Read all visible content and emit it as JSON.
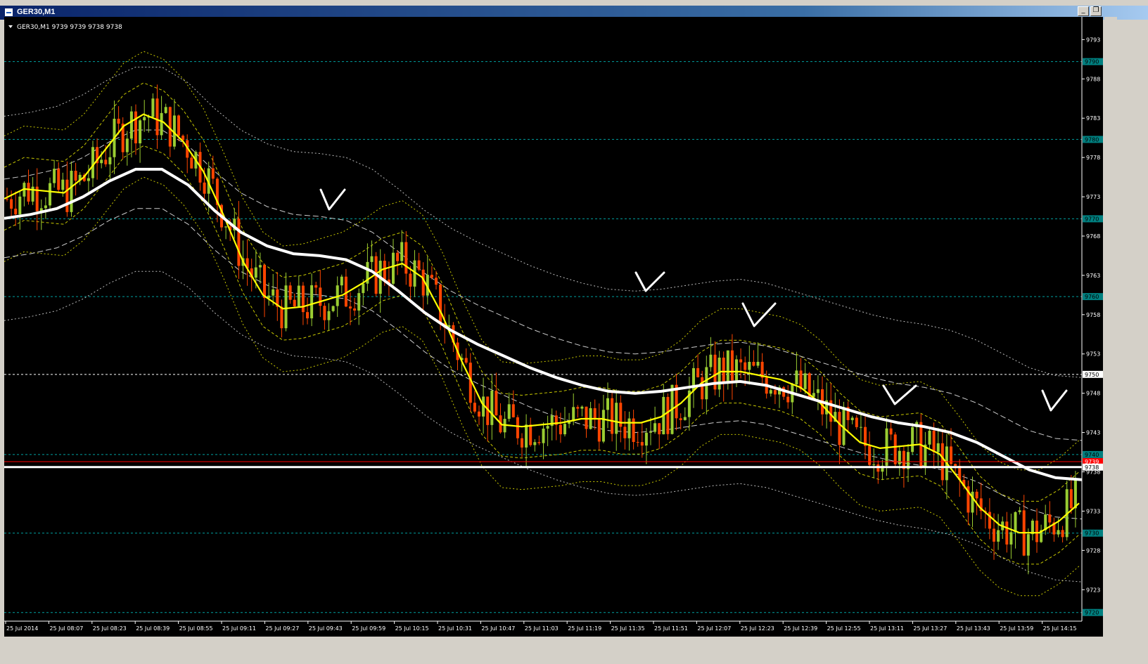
{
  "window": {
    "title": "GER30,M1"
  },
  "chart_info": {
    "text": "GER30,M1  9739 9739 9738 9738"
  },
  "colors": {
    "background": "#000000",
    "bull_candle": "#9acd32",
    "bear_candle": "#ff4500",
    "ma_fast": "#ffff00",
    "ma_slow": "#ffffff",
    "level_line": "#00a0a0",
    "bid_line": "#ff0000"
  },
  "price_axis": {
    "ticks": [
      {
        "label": "9793",
        "price": 9793
      },
      {
        "label": "9788",
        "price": 9788
      },
      {
        "label": "9783",
        "price": 9783
      },
      {
        "label": "9778",
        "price": 9778
      },
      {
        "label": "9773",
        "price": 9773
      },
      {
        "label": "9768",
        "price": 9768
      },
      {
        "label": "9763",
        "price": 9763
      },
      {
        "label": "9758",
        "price": 9758
      },
      {
        "label": "9753",
        "price": 9753
      },
      {
        "label": "9748",
        "price": 9748
      },
      {
        "label": "9743",
        "price": 9743
      },
      {
        "label": "9738",
        "price": 9738
      },
      {
        "label": "9733",
        "price": 9733
      },
      {
        "label": "9728",
        "price": 9728
      },
      {
        "label": "9723",
        "price": 9723
      }
    ],
    "levels": [
      {
        "label": "9790",
        "price": 9790.2
      },
      {
        "label": "9780",
        "price": 9780.3
      },
      {
        "label": "9770",
        "price": 9770.2
      },
      {
        "label": "9760",
        "price": 9760.3
      },
      {
        "label": "9740",
        "price": 9740.2
      },
      {
        "label": "9730",
        "price": 9730.2
      },
      {
        "label": "9720",
        "price": 9720.1
      }
    ],
    "white_level": {
      "label": "9750",
      "price": 9750.4
    },
    "bid": {
      "label": "9739",
      "price": 9739.3
    },
    "current": {
      "label": "9738",
      "price": 9738.6
    }
  },
  "time_axis": {
    "labels": [
      "25 Jul 2014",
      "25 Jul 08:07",
      "25 Jul 08:23",
      "25 Jul 08:39",
      "25 Jul 08:55",
      "25 Jul 09:11",
      "25 Jul 09:27",
      "25 Jul 09:43",
      "25 Jul 09:59",
      "25 Jul 10:15",
      "25 Jul 10:31",
      "25 Jul 10:47",
      "25 Jul 11:03",
      "25 Jul 11:19",
      "25 Jul 11:35",
      "25 Jul 11:51",
      "25 Jul 12:07",
      "25 Jul 12:23",
      "25 Jul 12:39",
      "25 Jul 12:55",
      "25 Jul 13:11",
      "25 Jul 13:27",
      "25 Jul 13:43",
      "25 Jul 13:59",
      "25 Jul 14:15"
    ]
  },
  "chart_data": {
    "type": "candlestick",
    "symbol": "GER30",
    "timeframe": "M1",
    "ylim": [
      9719,
      9795
    ],
    "ma_fast_values": [
      9772,
      9775,
      9774,
      9772,
      9776,
      9778,
      9783,
      9784,
      9783,
      9780,
      9777,
      9771,
      9764,
      9760,
      9758,
      9759,
      9760,
      9760,
      9762,
      9764,
      9765,
      9764,
      9758,
      9752,
      9746,
      9743,
      9744,
      9744,
      9744,
      9745,
      9745,
      9744,
      9744,
      9745,
      9746,
      9750,
      9751,
      9751,
      9750,
      9750,
      9749,
      9747,
      9744,
      9741,
      9741,
      9741,
      9742,
      9741,
      9737,
      9733,
      9731,
      9730,
      9730,
      9731,
      9735
    ],
    "ma_slow_values": [
      9770,
      9771,
      9771,
      9773,
      9775,
      9777,
      9777,
      9775,
      9771,
      9768,
      9767,
      9765,
      9766,
      9765,
      9764,
      9761,
      9758,
      9756,
      9754,
      9753,
      9751,
      9750,
      9749,
      9748,
      9748,
      9748,
      9749,
      9749,
      9750,
      9749,
      9748,
      9747,
      9746,
      9745,
      9744,
      9744,
      9743,
      9742,
      9740,
      9738,
      9737,
      9737
    ],
    "marks": [
      "check",
      "check",
      "check",
      "check",
      "check"
    ]
  }
}
